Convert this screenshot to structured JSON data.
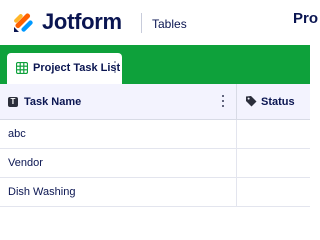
{
  "header": {
    "brand": "Jotform",
    "product": "Tables",
    "title_partial": "Pro"
  },
  "tabs": [
    {
      "label": "Project Task List",
      "icon": "spreadsheet-icon",
      "active": true
    }
  ],
  "table": {
    "columns": [
      {
        "label": "Task Name",
        "icon": "text-type-icon"
      },
      {
        "label": "Status",
        "icon": "tag-icon"
      }
    ],
    "rows": [
      {
        "task_name": "abc",
        "status": ""
      },
      {
        "task_name": "Vendor",
        "status": ""
      },
      {
        "task_name": "Dish Washing",
        "status": ""
      }
    ]
  },
  "colors": {
    "brand_navy": "#0a1551",
    "tabbar_green": "#0ea13b",
    "header_row_bg": "#f3f3fe",
    "logo_orange": "#ff6100",
    "logo_blue": "#0099ff",
    "logo_yellow": "#ffb629"
  }
}
